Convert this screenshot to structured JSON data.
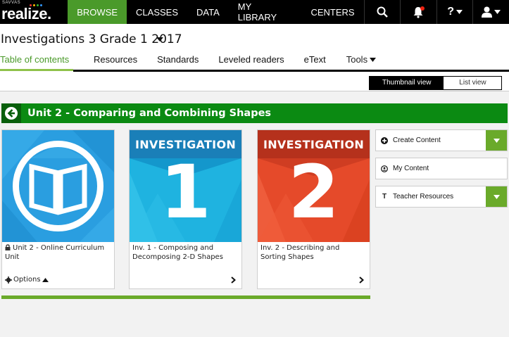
{
  "nav": {
    "brand_small": "SAVVAS",
    "brand_word": "realize.",
    "items": [
      {
        "label": "BROWSE",
        "active": true
      },
      {
        "label": "CLASSES",
        "active": false
      },
      {
        "label": "DATA",
        "active": false
      },
      {
        "label": "MY LIBRARY",
        "active": false
      },
      {
        "label": "CENTERS",
        "active": false
      }
    ],
    "help_label": "?",
    "icons": [
      "search-icon",
      "bell-icon",
      "help-icon",
      "user-icon"
    ]
  },
  "program": {
    "title": "Investigations 3 Grade 1 2017",
    "tabs": [
      {
        "label": "Table of contents",
        "active": true
      },
      {
        "label": "Resources",
        "active": false
      },
      {
        "label": "Standards",
        "active": false
      },
      {
        "label": "Leveled readers",
        "active": false
      },
      {
        "label": "eText",
        "active": false
      },
      {
        "label": "Tools",
        "active": false
      }
    ]
  },
  "view_toggle": {
    "thumbnail": "Thumbnail view",
    "list": "List view",
    "selected": "Thumbnail view"
  },
  "unit": {
    "title": "Unit 2 - Comparing and Combining Shapes"
  },
  "cards": [
    {
      "title": "Unit 2 - Online Curriculum Unit",
      "locked": true,
      "options_label": "Options",
      "thumb_text": "",
      "thumb_number": ""
    },
    {
      "title": "Inv. 1 - Composing and Decomposing 2-D Shapes",
      "thumb_text": "INVESTIGATION",
      "thumb_number": "1"
    },
    {
      "title": "Inv. 2 - Describing and Sorting Shapes",
      "thumb_text": "INVESTIGATION",
      "thumb_number": "2"
    }
  ],
  "side_panel": [
    {
      "label": "Create Content",
      "icon": "plus-circle-icon",
      "dropdown": true
    },
    {
      "label": "My Content",
      "icon": "person-circle-icon",
      "dropdown": false
    },
    {
      "label": "Teacher Resources",
      "icon": "text-t-icon",
      "icon_glyph": "T",
      "dropdown": true
    }
  ],
  "colors": {
    "nav_bg": "#000000",
    "browse_active": "#4a9a2a",
    "unit_green": "#0b8a12",
    "accent_green": "#6aaa2a",
    "card_blue": "#2a9ee0",
    "card_cyan": "#1fb3e0",
    "card_red": "#e54a2a"
  }
}
